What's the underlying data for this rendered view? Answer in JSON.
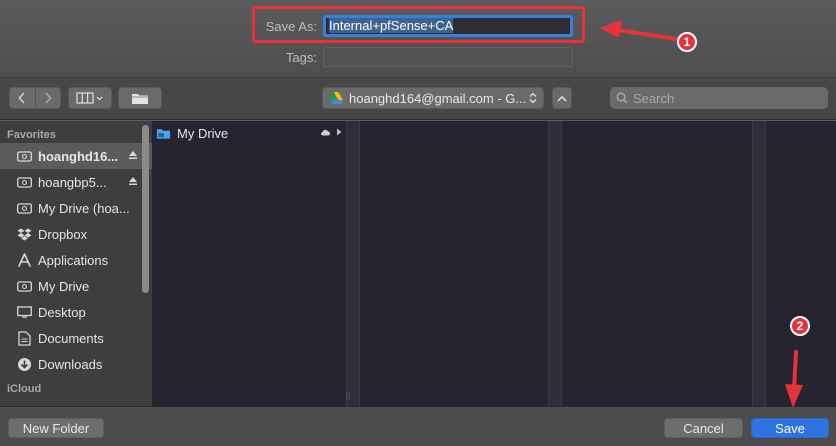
{
  "save_as": {
    "label": "Save As:",
    "value": "Internal+pfSense+CA"
  },
  "tags": {
    "label": "Tags:",
    "value": ""
  },
  "toolbar": {
    "location": "hoanghd164@gmail.com - G...",
    "search_placeholder": "Search"
  },
  "sidebar": {
    "favorites_heading": "Favorites",
    "icloud_heading": "iCloud",
    "items": [
      {
        "label": "hoanghd16...",
        "icon": "drive-icon",
        "selected": true,
        "eject": true
      },
      {
        "label": "hoangbp5...",
        "icon": "drive-icon",
        "selected": false,
        "eject": true
      },
      {
        "label": "My Drive (hoa...",
        "icon": "drive-icon",
        "selected": false,
        "eject": false
      },
      {
        "label": "Dropbox",
        "icon": "dropbox-icon",
        "selected": false,
        "eject": false
      },
      {
        "label": "Applications",
        "icon": "applications-icon",
        "selected": false,
        "eject": false
      },
      {
        "label": "My Drive",
        "icon": "drive-icon",
        "selected": false,
        "eject": false
      },
      {
        "label": "Desktop",
        "icon": "desktop-icon",
        "selected": false,
        "eject": false
      },
      {
        "label": "Documents",
        "icon": "documents-icon",
        "selected": false,
        "eject": false
      },
      {
        "label": "Downloads",
        "icon": "downloads-icon",
        "selected": false,
        "eject": false
      }
    ]
  },
  "browser": {
    "items": [
      {
        "label": "My Drive",
        "icon": "drive-folder-icon"
      }
    ]
  },
  "footer": {
    "new_folder": "New Folder",
    "cancel": "Cancel",
    "save": "Save"
  },
  "annotations": {
    "badge1": "1",
    "badge2": "2"
  },
  "colors": {
    "accent": "#2f73e0",
    "annotation": "#e5323b"
  }
}
